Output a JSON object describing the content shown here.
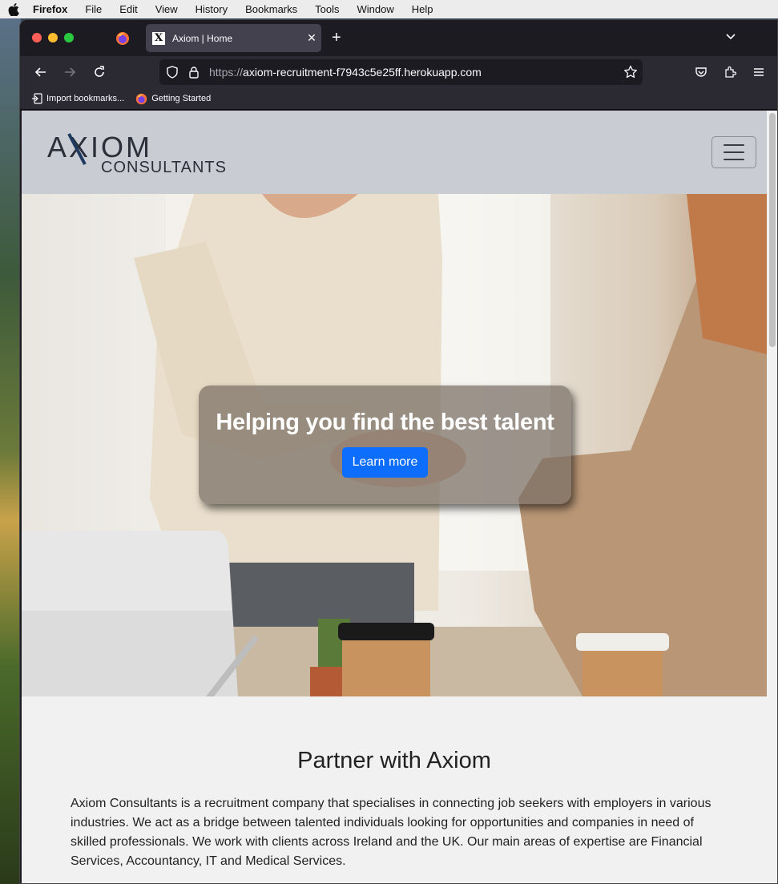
{
  "menubar": {
    "app": "Firefox",
    "items": [
      "File",
      "Edit",
      "View",
      "History",
      "Bookmarks",
      "Tools",
      "Window",
      "Help"
    ]
  },
  "browser": {
    "tab_title": "Axiom | Home",
    "tab_favicon": "X",
    "url_scheme": "https://",
    "url_host": "axiom-recruitment-f7943c5e25ff.herokuapp.com",
    "bookmarks": [
      "Import bookmarks...",
      "Getting Started"
    ]
  },
  "site": {
    "logo_top": "AXIOM",
    "logo_bottom": "CONSULTANTS",
    "hero_heading": "Helping you find the best talent",
    "hero_button": "Learn more",
    "partner_heading": "Partner with Axiom",
    "partner_text": "Axiom Consultants is a recruitment company that specialises in connecting job seekers with employers in various industries. We act as a bridge between talented individuals looking for opportunities and companies in need of skilled professionals. We work with clients across Ireland and the UK. Our main areas of expertise are Financial Services, Accountancy, IT and Medical Services."
  },
  "colors": {
    "accent_button": "#0d6efd",
    "header_bg": "#c9cdd3",
    "browser_chrome": "#2b2a33"
  },
  "icons": [
    "apple-icon",
    "firefox-icon",
    "close-icon",
    "plus-icon",
    "chevron-down-icon",
    "back-arrow-icon",
    "forward-arrow-icon",
    "reload-icon",
    "shield-icon",
    "lock-icon",
    "star-icon",
    "pocket-icon",
    "extensions-icon",
    "menu-icon",
    "import-icon",
    "hamburger-icon"
  ]
}
